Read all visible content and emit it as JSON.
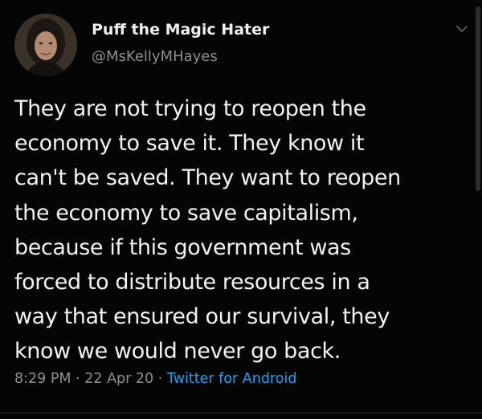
{
  "author": {
    "display_name": "Puff the Magic Hater",
    "handle": "@MsKellyMHayes"
  },
  "tweet": {
    "lines": [
      "They are not trying to reopen the",
      "economy to save it. They know it",
      "can't be saved. They want to reopen",
      "the economy to save capitalism,",
      "because if this government was",
      "forced to distribute resources in a",
      "way that ensured our survival, they",
      "know we would never go back."
    ],
    "time": "8:29 PM",
    "separator": "·",
    "date": "22 Apr 20",
    "source": "Twitter for Android"
  },
  "icons": {
    "menu": "chevron-down-icon"
  },
  "colors": {
    "background": "#050505",
    "text": "#f2f2f2",
    "muted": "#8a8f94",
    "accent": "#1da1f2"
  }
}
